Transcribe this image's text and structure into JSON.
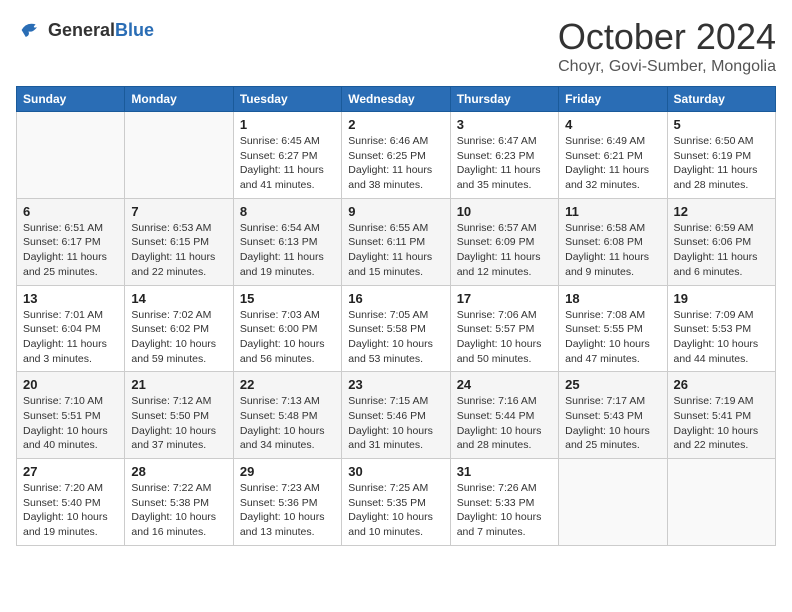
{
  "header": {
    "logo_general": "General",
    "logo_blue": "Blue",
    "month": "October 2024",
    "location": "Choyr, Govi-Sumber, Mongolia"
  },
  "days_of_week": [
    "Sunday",
    "Monday",
    "Tuesday",
    "Wednesday",
    "Thursday",
    "Friday",
    "Saturday"
  ],
  "weeks": [
    [
      {
        "num": "",
        "info": ""
      },
      {
        "num": "",
        "info": ""
      },
      {
        "num": "1",
        "info": "Sunrise: 6:45 AM\nSunset: 6:27 PM\nDaylight: 11 hours and 41 minutes."
      },
      {
        "num": "2",
        "info": "Sunrise: 6:46 AM\nSunset: 6:25 PM\nDaylight: 11 hours and 38 minutes."
      },
      {
        "num": "3",
        "info": "Sunrise: 6:47 AM\nSunset: 6:23 PM\nDaylight: 11 hours and 35 minutes."
      },
      {
        "num": "4",
        "info": "Sunrise: 6:49 AM\nSunset: 6:21 PM\nDaylight: 11 hours and 32 minutes."
      },
      {
        "num": "5",
        "info": "Sunrise: 6:50 AM\nSunset: 6:19 PM\nDaylight: 11 hours and 28 minutes."
      }
    ],
    [
      {
        "num": "6",
        "info": "Sunrise: 6:51 AM\nSunset: 6:17 PM\nDaylight: 11 hours and 25 minutes."
      },
      {
        "num": "7",
        "info": "Sunrise: 6:53 AM\nSunset: 6:15 PM\nDaylight: 11 hours and 22 minutes."
      },
      {
        "num": "8",
        "info": "Sunrise: 6:54 AM\nSunset: 6:13 PM\nDaylight: 11 hours and 19 minutes."
      },
      {
        "num": "9",
        "info": "Sunrise: 6:55 AM\nSunset: 6:11 PM\nDaylight: 11 hours and 15 minutes."
      },
      {
        "num": "10",
        "info": "Sunrise: 6:57 AM\nSunset: 6:09 PM\nDaylight: 11 hours and 12 minutes."
      },
      {
        "num": "11",
        "info": "Sunrise: 6:58 AM\nSunset: 6:08 PM\nDaylight: 11 hours and 9 minutes."
      },
      {
        "num": "12",
        "info": "Sunrise: 6:59 AM\nSunset: 6:06 PM\nDaylight: 11 hours and 6 minutes."
      }
    ],
    [
      {
        "num": "13",
        "info": "Sunrise: 7:01 AM\nSunset: 6:04 PM\nDaylight: 11 hours and 3 minutes."
      },
      {
        "num": "14",
        "info": "Sunrise: 7:02 AM\nSunset: 6:02 PM\nDaylight: 10 hours and 59 minutes."
      },
      {
        "num": "15",
        "info": "Sunrise: 7:03 AM\nSunset: 6:00 PM\nDaylight: 10 hours and 56 minutes."
      },
      {
        "num": "16",
        "info": "Sunrise: 7:05 AM\nSunset: 5:58 PM\nDaylight: 10 hours and 53 minutes."
      },
      {
        "num": "17",
        "info": "Sunrise: 7:06 AM\nSunset: 5:57 PM\nDaylight: 10 hours and 50 minutes."
      },
      {
        "num": "18",
        "info": "Sunrise: 7:08 AM\nSunset: 5:55 PM\nDaylight: 10 hours and 47 minutes."
      },
      {
        "num": "19",
        "info": "Sunrise: 7:09 AM\nSunset: 5:53 PM\nDaylight: 10 hours and 44 minutes."
      }
    ],
    [
      {
        "num": "20",
        "info": "Sunrise: 7:10 AM\nSunset: 5:51 PM\nDaylight: 10 hours and 40 minutes."
      },
      {
        "num": "21",
        "info": "Sunrise: 7:12 AM\nSunset: 5:50 PM\nDaylight: 10 hours and 37 minutes."
      },
      {
        "num": "22",
        "info": "Sunrise: 7:13 AM\nSunset: 5:48 PM\nDaylight: 10 hours and 34 minutes."
      },
      {
        "num": "23",
        "info": "Sunrise: 7:15 AM\nSunset: 5:46 PM\nDaylight: 10 hours and 31 minutes."
      },
      {
        "num": "24",
        "info": "Sunrise: 7:16 AM\nSunset: 5:44 PM\nDaylight: 10 hours and 28 minutes."
      },
      {
        "num": "25",
        "info": "Sunrise: 7:17 AM\nSunset: 5:43 PM\nDaylight: 10 hours and 25 minutes."
      },
      {
        "num": "26",
        "info": "Sunrise: 7:19 AM\nSunset: 5:41 PM\nDaylight: 10 hours and 22 minutes."
      }
    ],
    [
      {
        "num": "27",
        "info": "Sunrise: 7:20 AM\nSunset: 5:40 PM\nDaylight: 10 hours and 19 minutes."
      },
      {
        "num": "28",
        "info": "Sunrise: 7:22 AM\nSunset: 5:38 PM\nDaylight: 10 hours and 16 minutes."
      },
      {
        "num": "29",
        "info": "Sunrise: 7:23 AM\nSunset: 5:36 PM\nDaylight: 10 hours and 13 minutes."
      },
      {
        "num": "30",
        "info": "Sunrise: 7:25 AM\nSunset: 5:35 PM\nDaylight: 10 hours and 10 minutes."
      },
      {
        "num": "31",
        "info": "Sunrise: 7:26 AM\nSunset: 5:33 PM\nDaylight: 10 hours and 7 minutes."
      },
      {
        "num": "",
        "info": ""
      },
      {
        "num": "",
        "info": ""
      }
    ]
  ]
}
